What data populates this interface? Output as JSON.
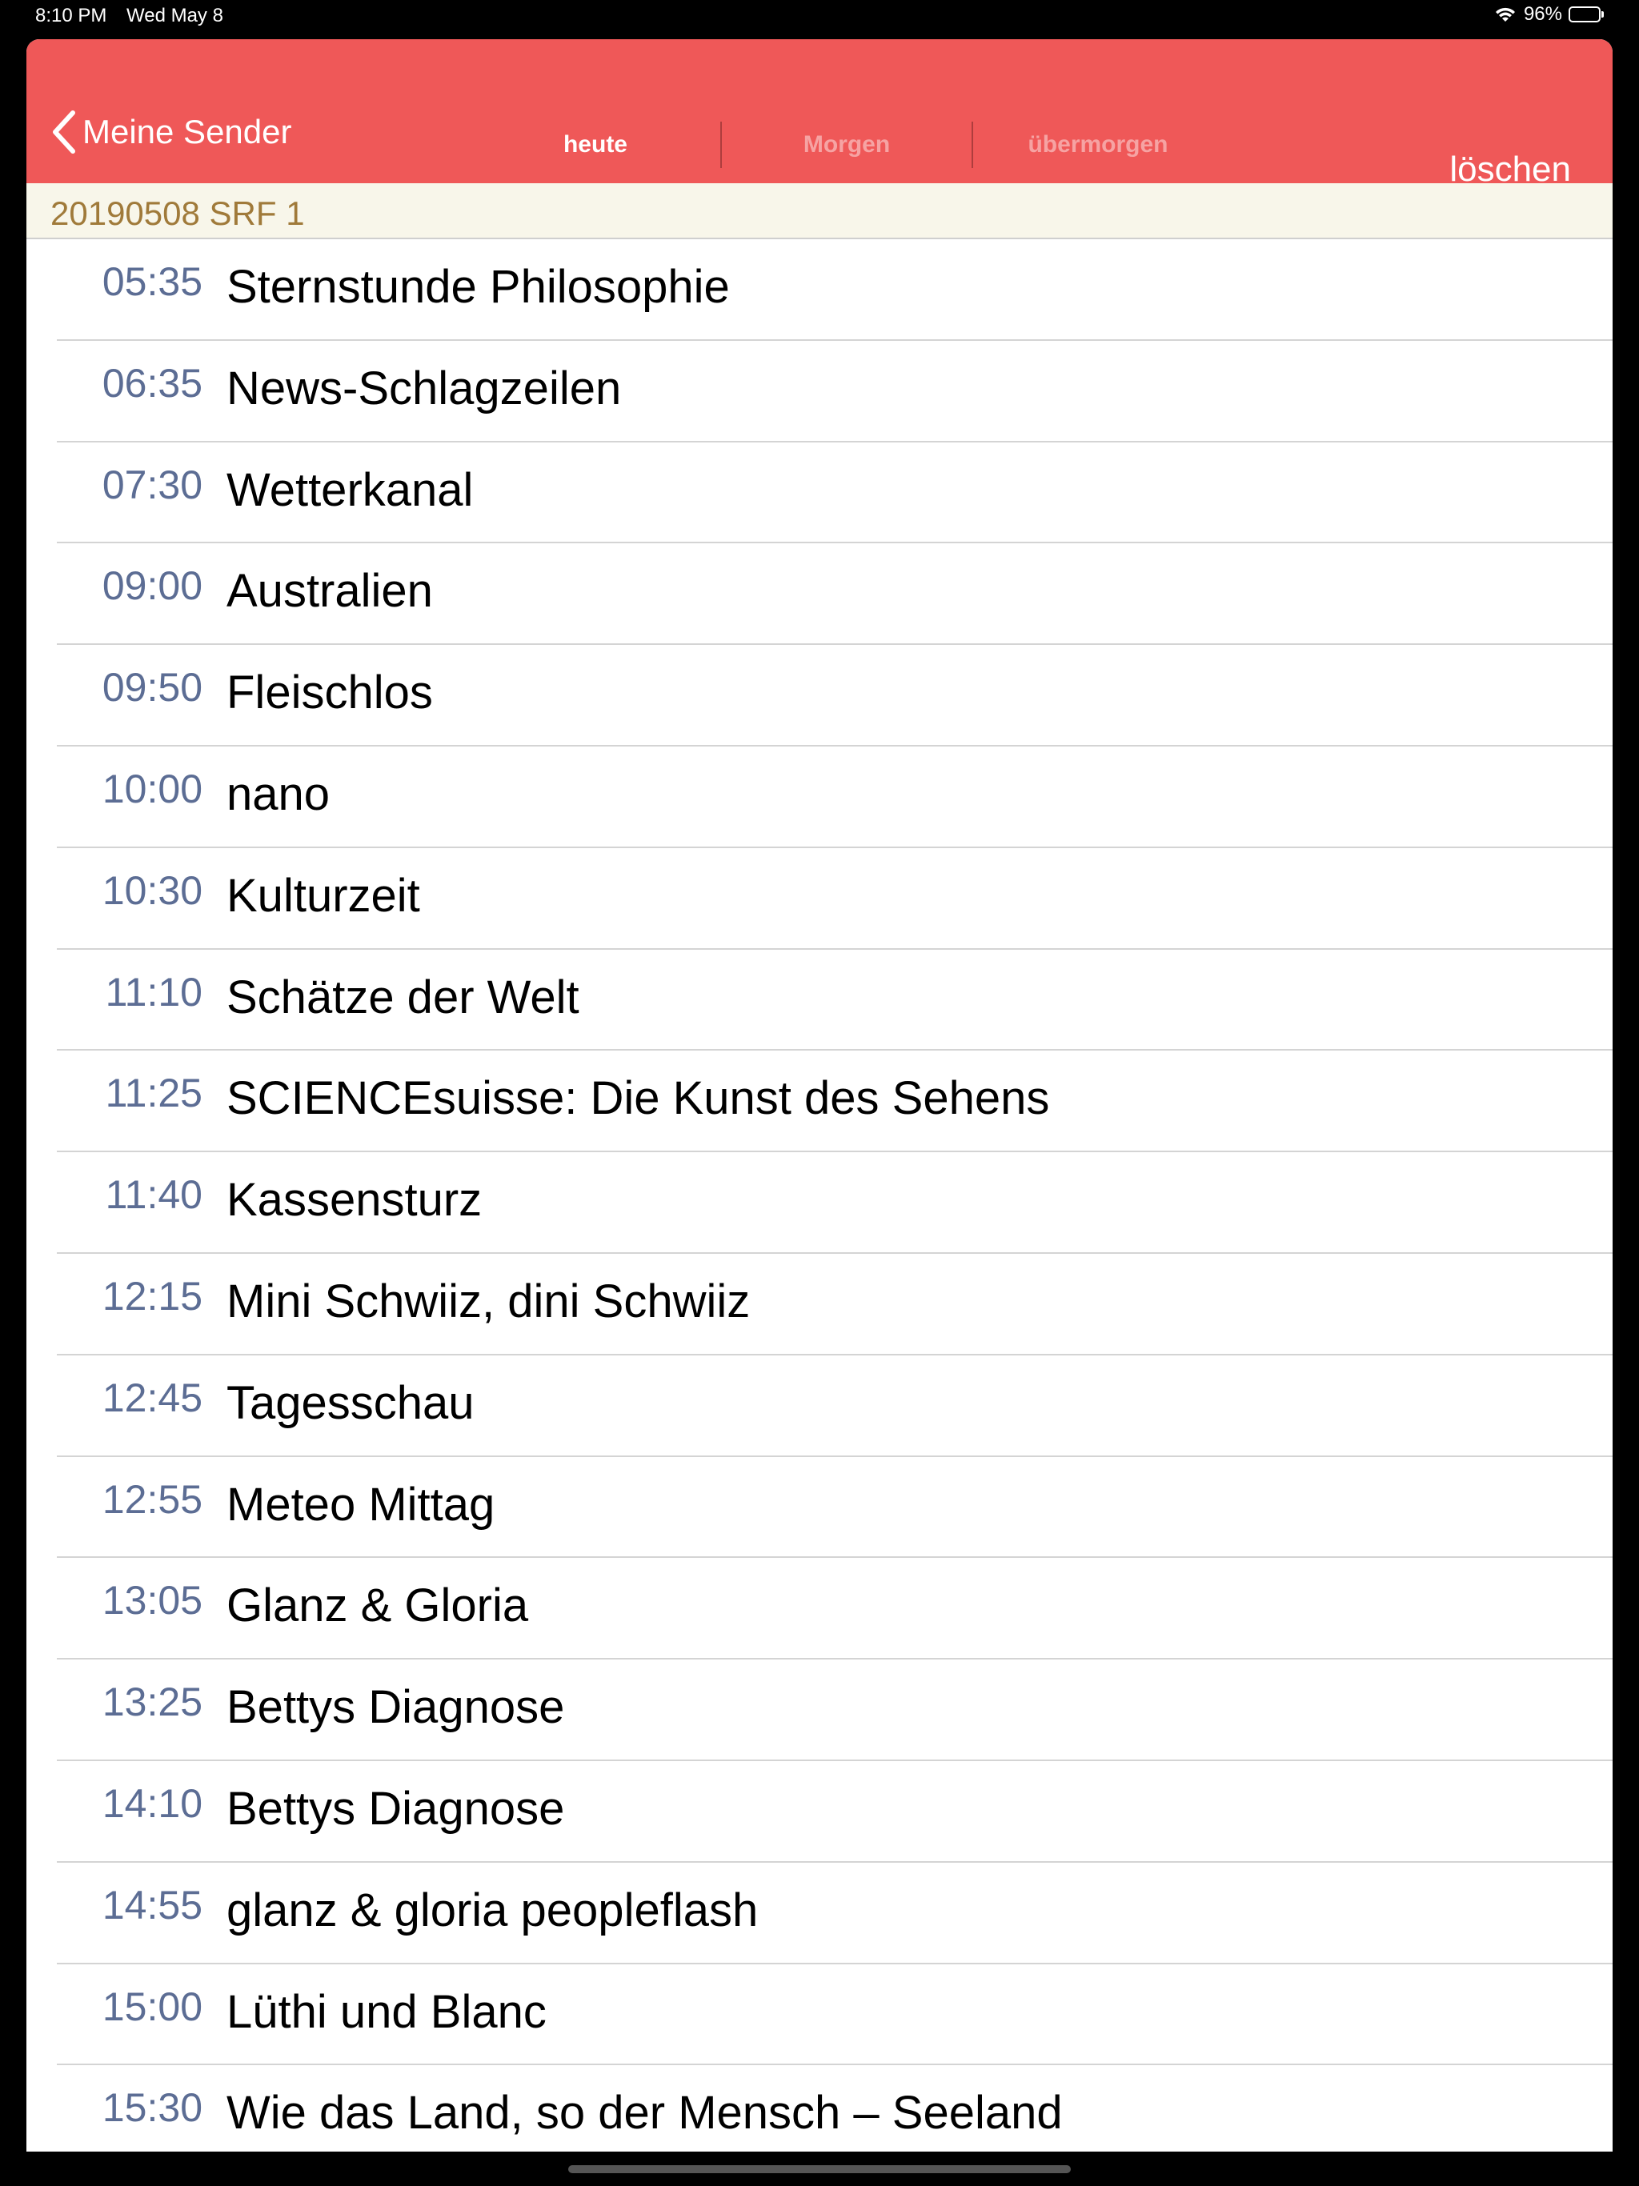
{
  "status_bar": {
    "time": "8:10 PM",
    "date": "Wed May 8",
    "battery_percent_label": "96%",
    "battery_level": 0.96,
    "wifi_icon": "wifi-icon",
    "battery_icon": "battery-charging-icon"
  },
  "navbar": {
    "background_color": "#ef5858",
    "back_label": "Meine Sender",
    "back_icon": "chevron-left-icon",
    "tabs": [
      {
        "label": "heute",
        "active": true
      },
      {
        "label": "Morgen",
        "active": false
      },
      {
        "label": "übermorgen",
        "active": false
      }
    ],
    "delete_label": "löschen"
  },
  "section": {
    "title": "20190508 SRF 1"
  },
  "programs": [
    {
      "time": "05:35",
      "title": "Sternstunde Philosophie"
    },
    {
      "time": "06:35",
      "title": "News-Schlagzeilen"
    },
    {
      "time": "07:30",
      "title": "Wetterkanal"
    },
    {
      "time": "09:00",
      "title": "Australien"
    },
    {
      "time": "09:50",
      "title": "Fleischlos"
    },
    {
      "time": "10:00",
      "title": "nano"
    },
    {
      "time": "10:30",
      "title": "Kulturzeit"
    },
    {
      "time": "11:10",
      "title": "Schätze der Welt"
    },
    {
      "time": "11:25",
      "title": "SCIENCEsuisse: Die Kunst des Sehens"
    },
    {
      "time": "11:40",
      "title": "Kassensturz"
    },
    {
      "time": "12:15",
      "title": "Mini Schwiiz, dini Schwiiz"
    },
    {
      "time": "12:45",
      "title": "Tagesschau"
    },
    {
      "time": "12:55",
      "title": "Meteo Mittag"
    },
    {
      "time": "13:05",
      "title": "Glanz & Gloria"
    },
    {
      "time": "13:25",
      "title": "Bettys Diagnose"
    },
    {
      "time": "14:10",
      "title": "Bettys Diagnose"
    },
    {
      "time": "14:55",
      "title": "glanz & gloria peopleflash"
    },
    {
      "time": "15:00",
      "title": "Lüthi und Blanc"
    },
    {
      "time": "15:30",
      "title": "Wie das Land, so der Mensch – Seeland"
    }
  ]
}
